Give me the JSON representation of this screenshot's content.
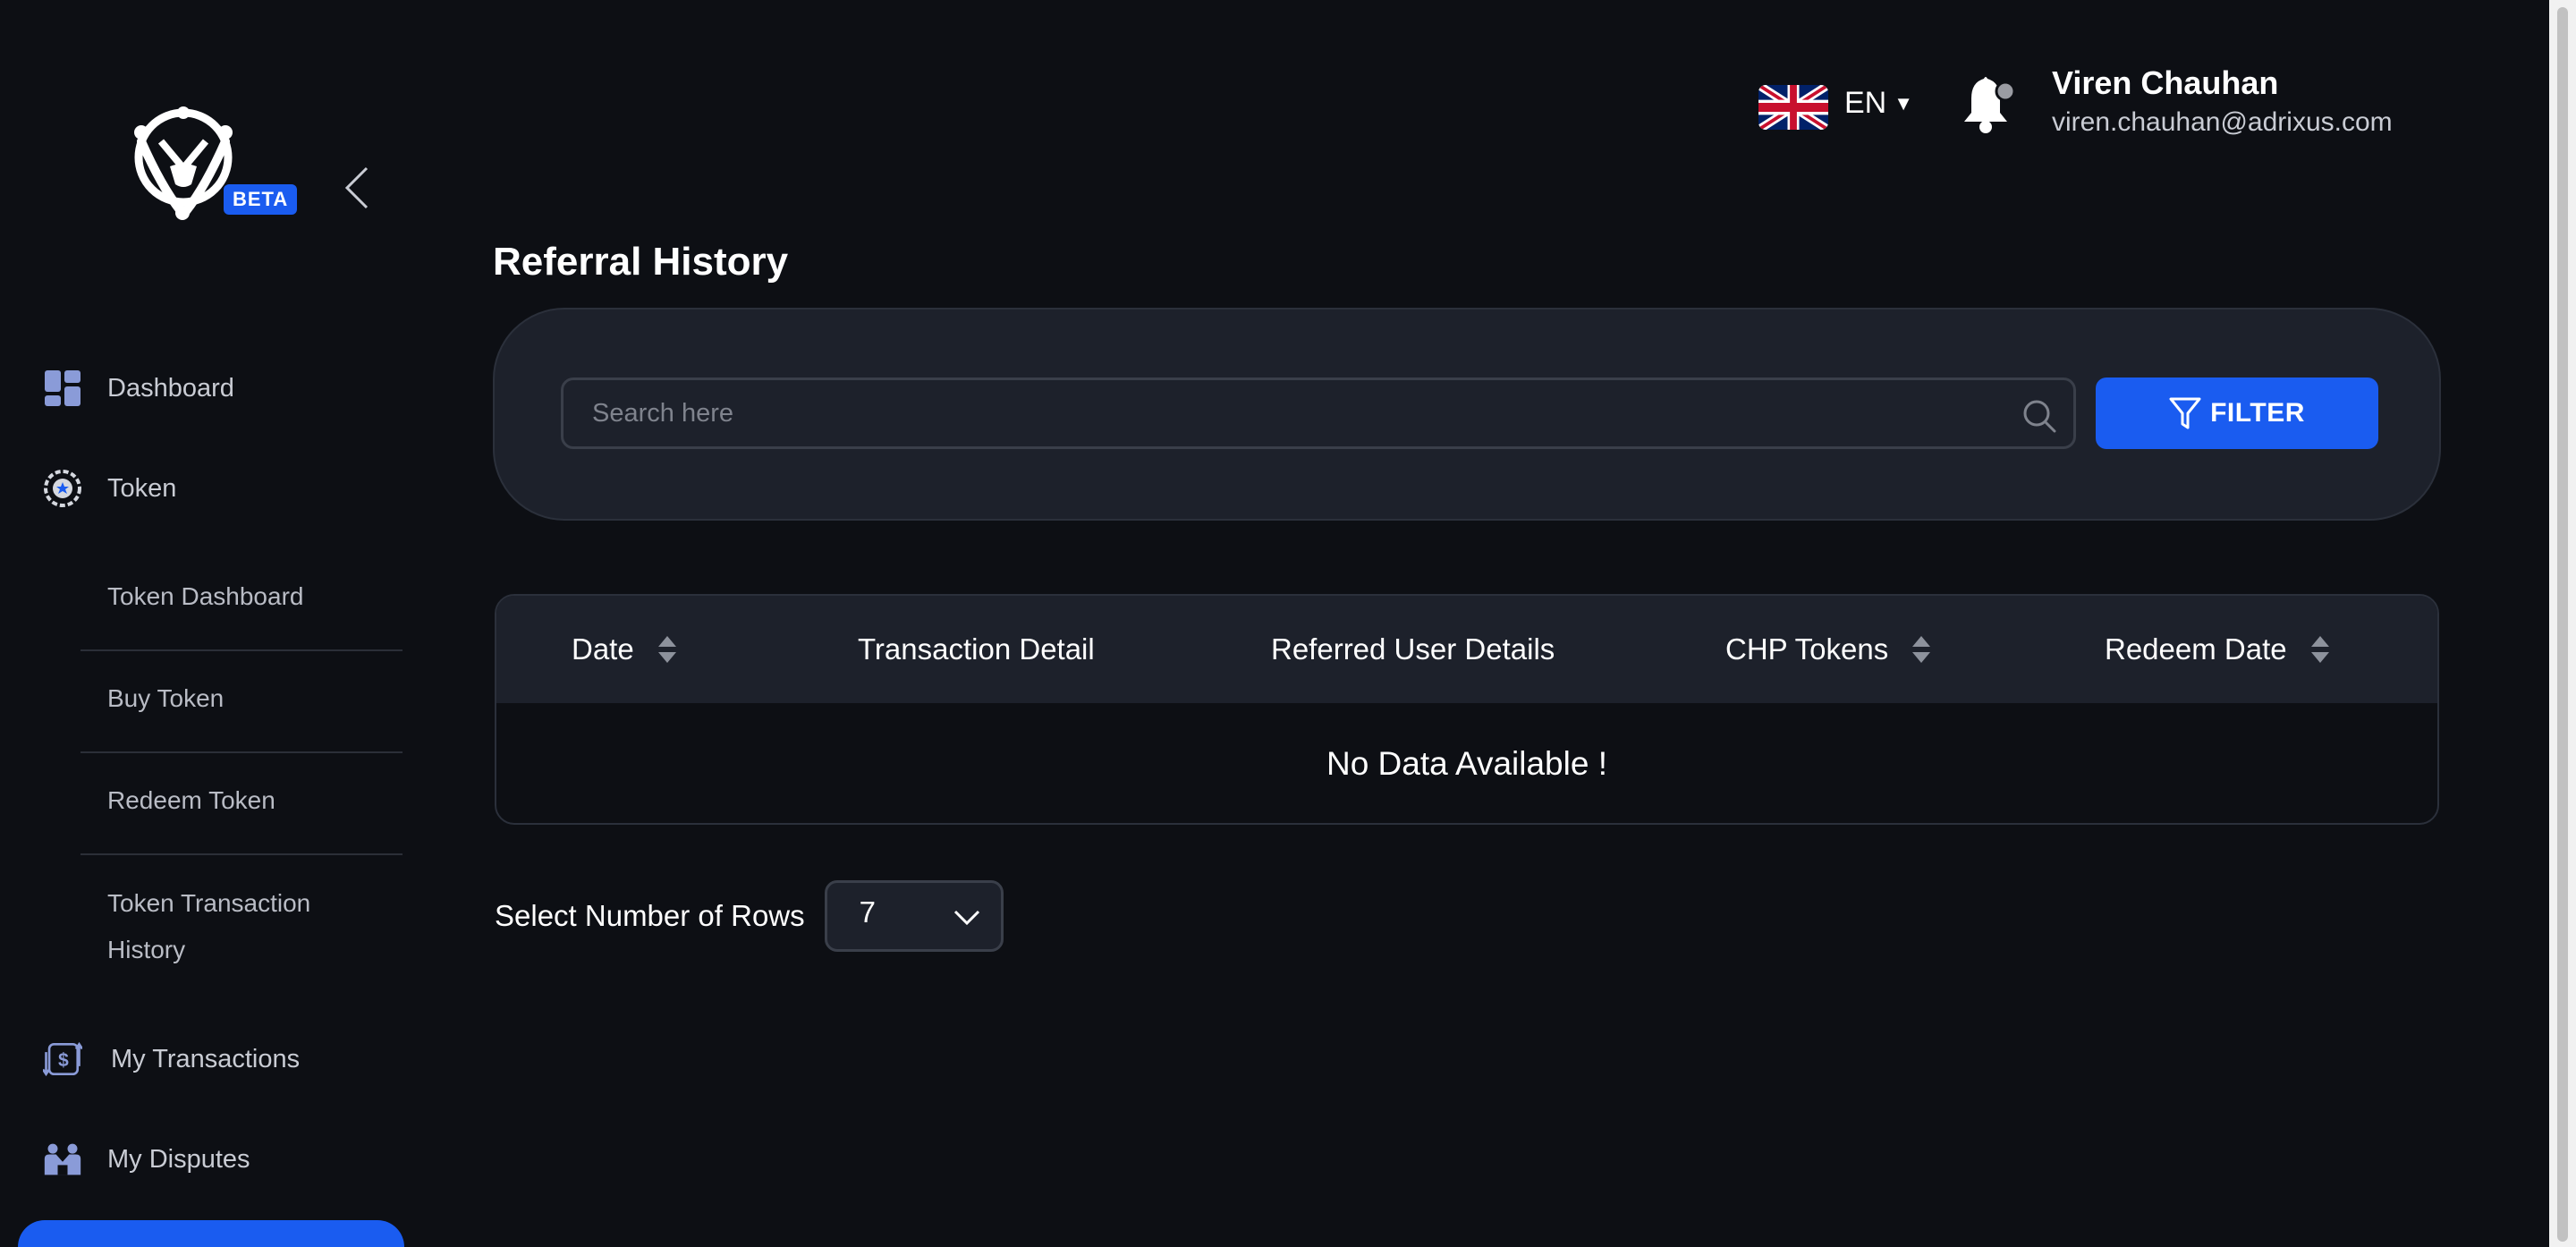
{
  "sidebar": {
    "beta_label": "BETA",
    "items": [
      {
        "label": "Dashboard",
        "icon": "dashboard-icon"
      },
      {
        "label": "Token",
        "icon": "token-icon"
      },
      {
        "label": "My Transactions",
        "icon": "transactions-icon"
      },
      {
        "label": "My Disputes",
        "icon": "disputes-icon"
      }
    ],
    "token_sub_items": [
      {
        "label": "Token Dashboard"
      },
      {
        "label": "Buy Token"
      },
      {
        "label": "Redeem Token"
      },
      {
        "label": "Token Transaction History"
      }
    ]
  },
  "header": {
    "language": "EN",
    "user_name": "Viren Chauhan",
    "user_email": "viren.chauhan@adrixus.com"
  },
  "main": {
    "title": "Referral History",
    "search_placeholder": "Search here",
    "filter_label": "FILTER",
    "table": {
      "columns": [
        "Date",
        "Transaction Detail",
        "Referred User Details",
        "CHP Tokens",
        "Redeem Date"
      ],
      "sortable": [
        true,
        false,
        false,
        true,
        true
      ],
      "empty_message": "No Data Available !"
    },
    "rows_label": "Select Number of Rows",
    "rows_value": "7"
  },
  "colors": {
    "background": "#0d0f14",
    "card": "#1d212b",
    "accent": "#1a5cf0"
  }
}
